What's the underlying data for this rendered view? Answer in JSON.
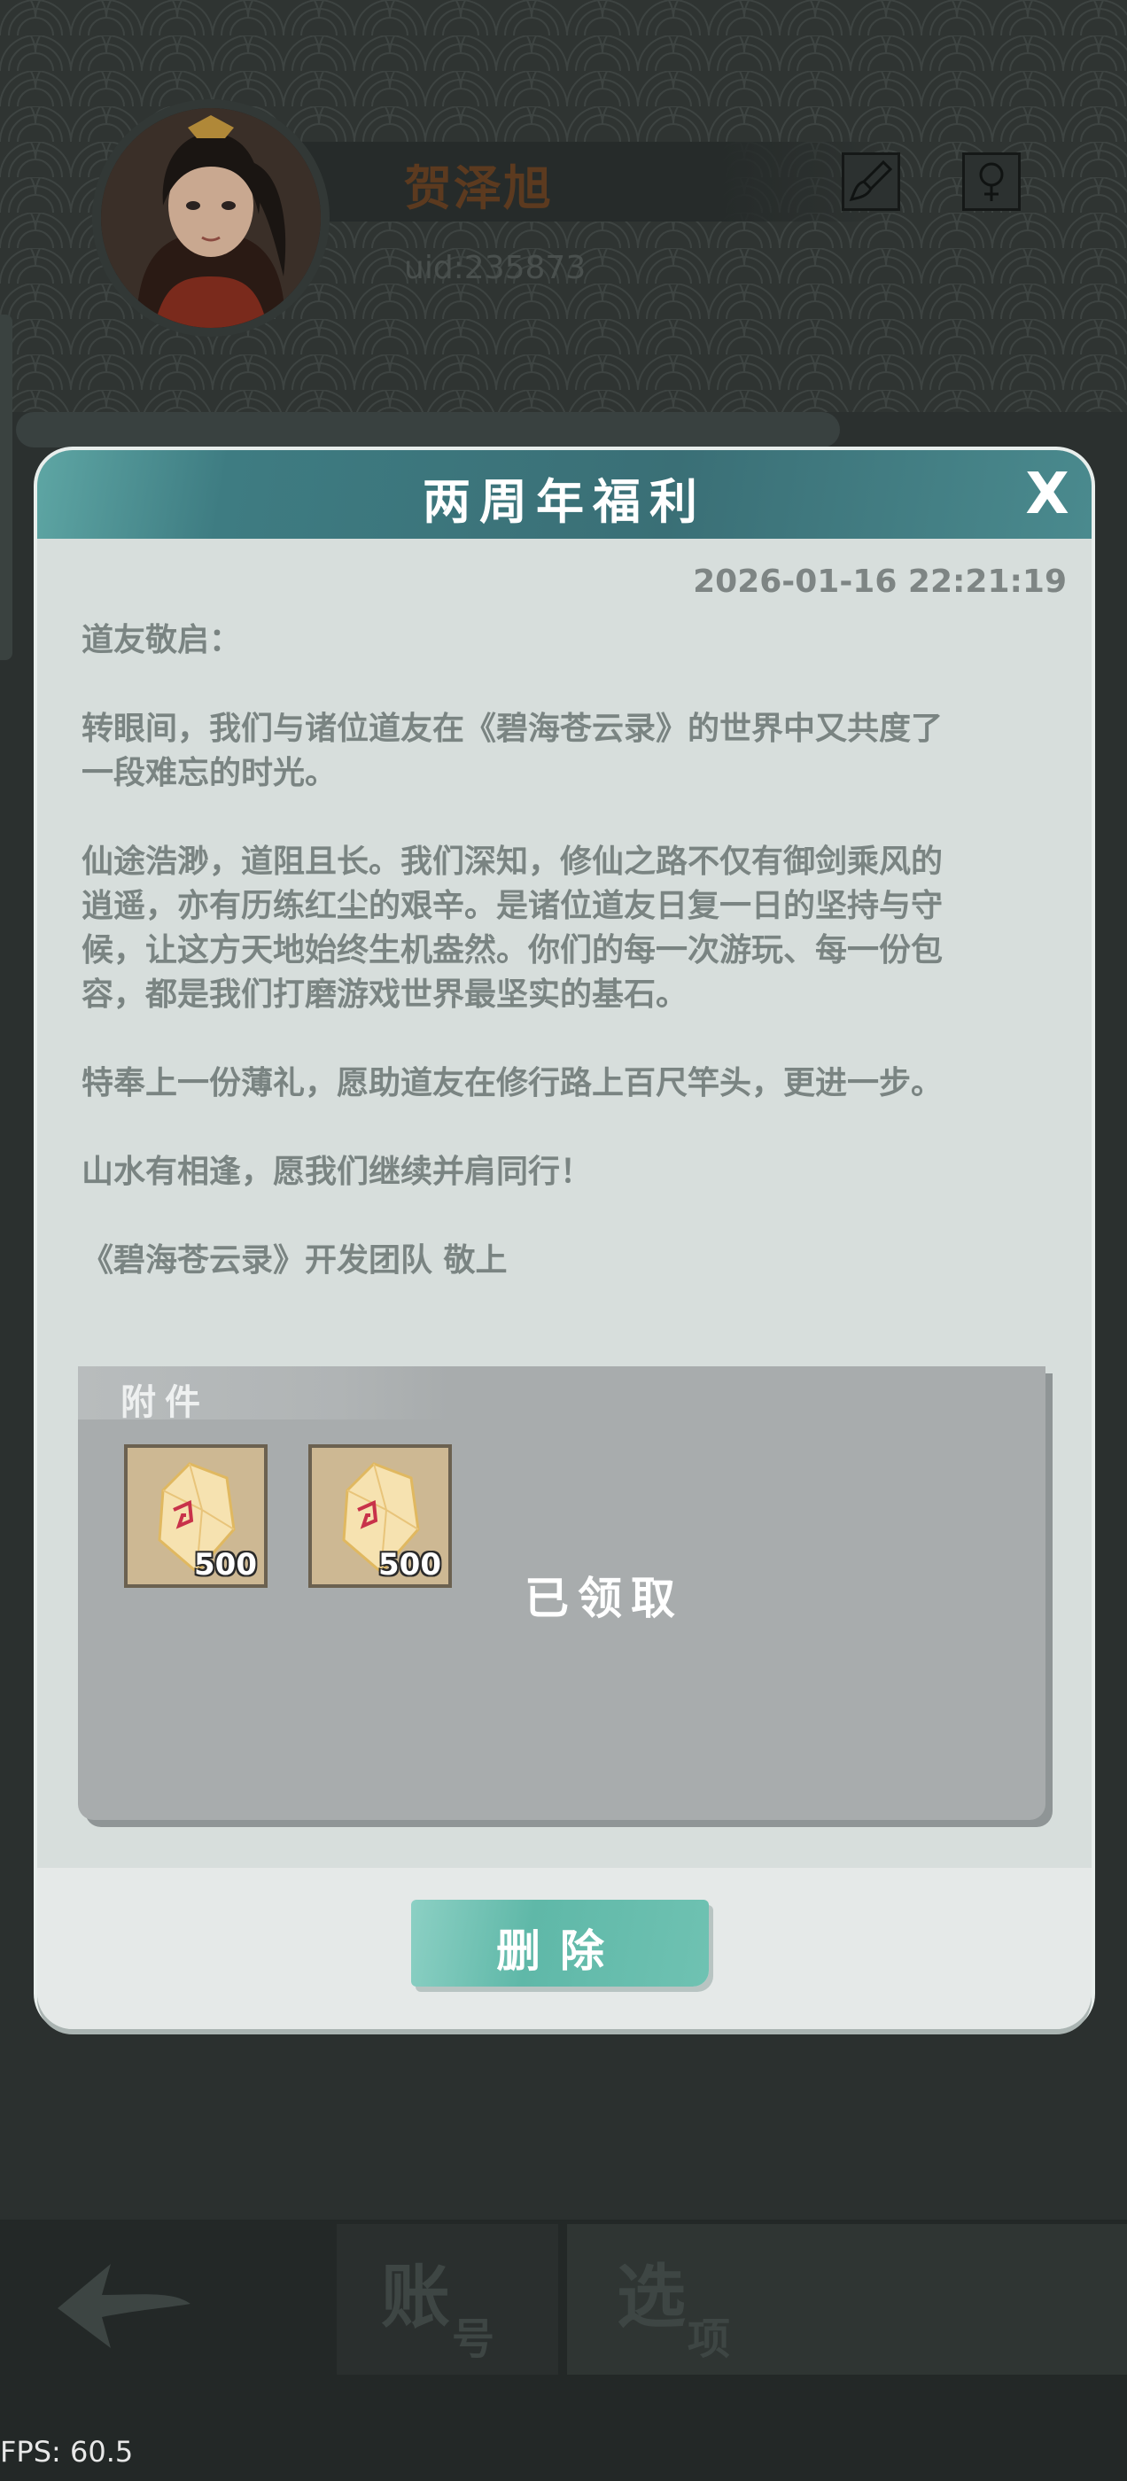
{
  "profile": {
    "name": "贺泽旭",
    "uid": "uid:235873",
    "icons": [
      "brush-icon",
      "profile-icon"
    ]
  },
  "dialog": {
    "title": "两周年福利",
    "close_label": "X",
    "timestamp": "2026-01-16 22:21:19",
    "paragraphs": [
      "道友敬启：",
      "转眼间，我们与诸位道友在《碧海苍云录》的世界中又共度了\n一段难忘的时光。",
      "仙途浩渺，道阻且长。我们深知，修仙之路不仅有御剑乘风的\n逍遥，亦有历练红尘的艰辛。是诸位道友日复一日的坚持与守\n候，让这方天地始终生机盎然。你们的每一次游玩、每一份包\n容，都是我们打磨游戏世界最坚实的基石。",
      "特奉上一份薄礼，愿助道友在修行路上百尺竿头，更进一步。",
      "山水有相逢，愿我们继续并肩同行！",
      "《碧海苍云录》开发团队 敬上"
    ],
    "attachments": {
      "label": "附件",
      "items": [
        {
          "icon": "spirit-crystal-icon",
          "quantity": "500"
        },
        {
          "icon": "spirit-crystal-icon",
          "quantity": "500"
        }
      ],
      "status": "已领取"
    },
    "delete_label": "删除"
  },
  "bottom_nav": {
    "back_icon": "back-arrow-icon",
    "account_big": "账",
    "account_small": "号",
    "options_big": "选",
    "options_small": "项"
  },
  "fps": "FPS: 60.5",
  "colors": {
    "header_teal": "#3e7c82",
    "button_teal": "#5fb8a8",
    "dialog_bg": "#d7dedc",
    "name_brown": "#5c3a1f"
  }
}
